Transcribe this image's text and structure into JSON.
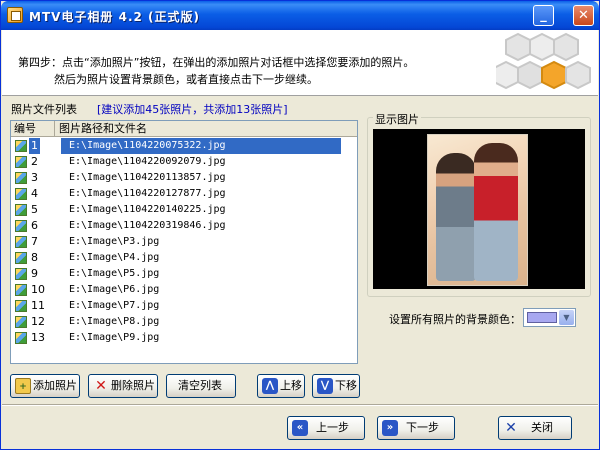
{
  "window": {
    "title": "MTV电子相册 4.2  (正式版)",
    "minimize_glyph": "_",
    "close_glyph": "✕"
  },
  "header": {
    "step_line1": "第四步：点击“添加照片”按钮，在弹出的添加照片对话框中选择您要添加的照片。",
    "step_line2": "然后为照片设置背景颜色，或者直接点击下一步继续。",
    "logo_icon": "hexagon-logo-icon"
  },
  "photo_list": {
    "title": "照片文件列表",
    "hint": "[建议添加45张照片，共添加13张照片]",
    "columns": [
      "编号",
      "图片路径和文件名"
    ],
    "rows": [
      {
        "num": "1",
        "path": "E:\\Image\\1104220075322.jpg",
        "selected": true
      },
      {
        "num": "2",
        "path": "E:\\Image\\1104220092079.jpg"
      },
      {
        "num": "3",
        "path": "E:\\Image\\1104220113857.jpg"
      },
      {
        "num": "4",
        "path": "E:\\Image\\1104220127877.jpg"
      },
      {
        "num": "5",
        "path": "E:\\Image\\1104220140225.jpg"
      },
      {
        "num": "6",
        "path": "E:\\Image\\1104220319846.jpg"
      },
      {
        "num": "7",
        "path": "E:\\Image\\P3.jpg"
      },
      {
        "num": "8",
        "path": "E:\\Image\\P4.jpg"
      },
      {
        "num": "9",
        "path": "E:\\Image\\P5.jpg"
      },
      {
        "num": "10",
        "path": "E:\\Image\\P6.jpg"
      },
      {
        "num": "11",
        "path": "E:\\Image\\P7.jpg"
      },
      {
        "num": "12",
        "path": "E:\\Image\\P8.jpg"
      },
      {
        "num": "13",
        "path": "E:\\Image\\P9.jpg"
      }
    ],
    "selected_color": "#316ac5"
  },
  "preview": {
    "label": "显示图片",
    "background_color_label": "设置所有照片的背景颜色：",
    "background_color": "#a8a8f0"
  },
  "list_buttons": {
    "add": "添加照片",
    "delete": "删除照片",
    "clear": "清空列表",
    "up": "上移",
    "down": "下移"
  },
  "nav_buttons": {
    "prev": "上一步",
    "next": "下一步",
    "close": "关闭"
  }
}
